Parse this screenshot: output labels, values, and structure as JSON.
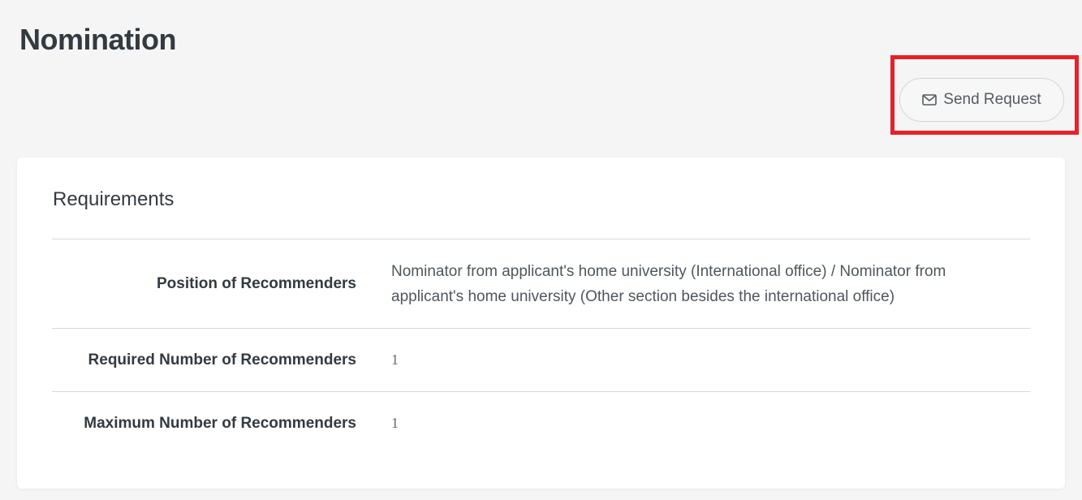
{
  "page": {
    "title": "Nomination"
  },
  "actions": {
    "send_request_label": "Send Request",
    "send_request_icon": "envelope-icon",
    "highlight_color": "#e8202a"
  },
  "requirements": {
    "title": "Requirements",
    "rows": [
      {
        "label": "Position of Recommenders",
        "value": "Nominator from applicant's home university (International office) / Nominator from applicant's home university (Other section besides the international office)"
      },
      {
        "label": "Required Number of Recommenders",
        "value": "1"
      },
      {
        "label": "Maximum Number of Recommenders",
        "value": "1"
      }
    ]
  }
}
